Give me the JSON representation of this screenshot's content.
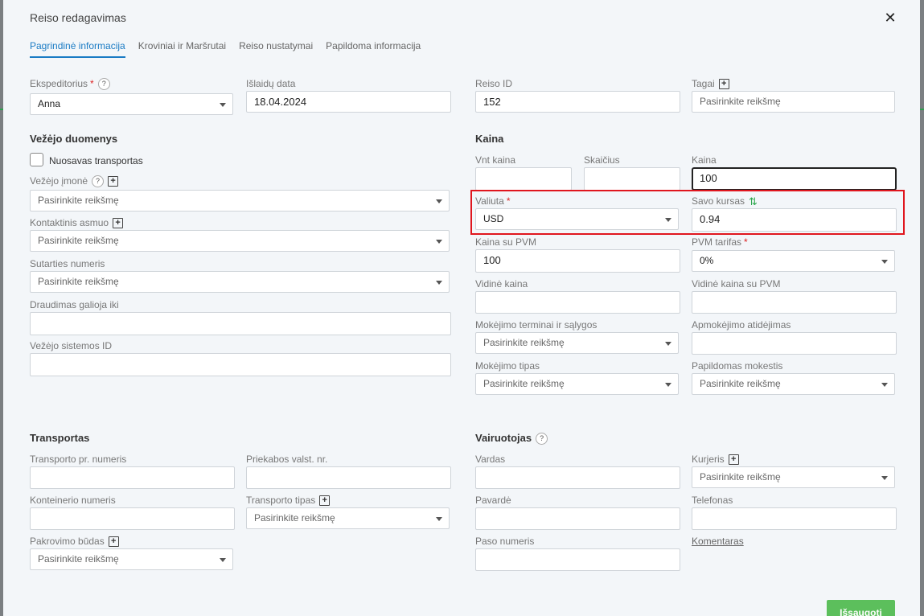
{
  "modal": {
    "title": "Reiso redagavimas"
  },
  "tabs": [
    "Pagrindinė informacija",
    "Kroviniai ir Maršrutai",
    "Reiso nustatymai",
    "Papildoma informacija"
  ],
  "labels": {
    "ekspeditorius": "Ekspeditorius",
    "isl_data": "Išlaidų data",
    "reiso_id": "Reiso ID",
    "tagai": "Tagai",
    "vezejo_duomenys": "Vežėjo duomenys",
    "nuosavas": "Nuosavas transportas",
    "vezejo_imone": "Vežėjo įmonė",
    "kontaktinis": "Kontaktinis asmuo",
    "sutarties_nr": "Sutarties numeris",
    "draudimas": "Draudimas galioja iki",
    "vezejo_sist_id": "Vežėjo sistemos ID",
    "kaina_title": "Kaina",
    "vnt_kaina": "Vnt kaina",
    "skaicius": "Skaičius",
    "kaina": "Kaina",
    "valiuta": "Valiuta",
    "savo_kursas": "Savo kursas",
    "kaina_su_pvm": "Kaina su PVM",
    "pvm_tarifas": "PVM tarifas",
    "vidine_kaina": "Vidinė kaina",
    "vidine_kaina_pvm": "Vidinė kaina su PVM",
    "mok_terminai": "Mokėjimo terminai ir sąlygos",
    "apm_atidejimas": "Apmokėjimo atidėjimas",
    "mok_tipas": "Mokėjimo tipas",
    "pap_mokestis": "Papildomas mokestis",
    "transportas": "Transportas",
    "transp_nr": "Transporto pr. numeris",
    "priekabos_nr": "Priekabos valst. nr.",
    "konteinerio_nr": "Konteinerio numeris",
    "transp_tipas": "Transporto tipas",
    "pakrovimo_budas": "Pakrovimo būdas",
    "vairuotojas": "Vairuotojas",
    "vardas": "Vardas",
    "kurjeris": "Kurjeris",
    "pavarde": "Pavardė",
    "telefonas": "Telefonas",
    "paso_nr": "Paso numeris",
    "komentaras": "Komentaras"
  },
  "values": {
    "ekspeditorius": "Anna",
    "isl_data": "18.04.2024",
    "reiso_id": "152",
    "kaina": "100",
    "valiuta": "USD",
    "savo_kursas": "0.94",
    "kaina_su_pvm": "100",
    "pvm_tarifas": "0%"
  },
  "placeholder": "Pasirinkite reikšmę",
  "buttons": {
    "save": "Išsaugoti"
  },
  "icons": {
    "help": "?",
    "add": "+",
    "close": "✕",
    "swap": "⇅"
  },
  "colors": {
    "accent": "#1a7bc4",
    "save": "#5cbf5c",
    "highlight": "#e0161e",
    "required": "#dd2222"
  }
}
